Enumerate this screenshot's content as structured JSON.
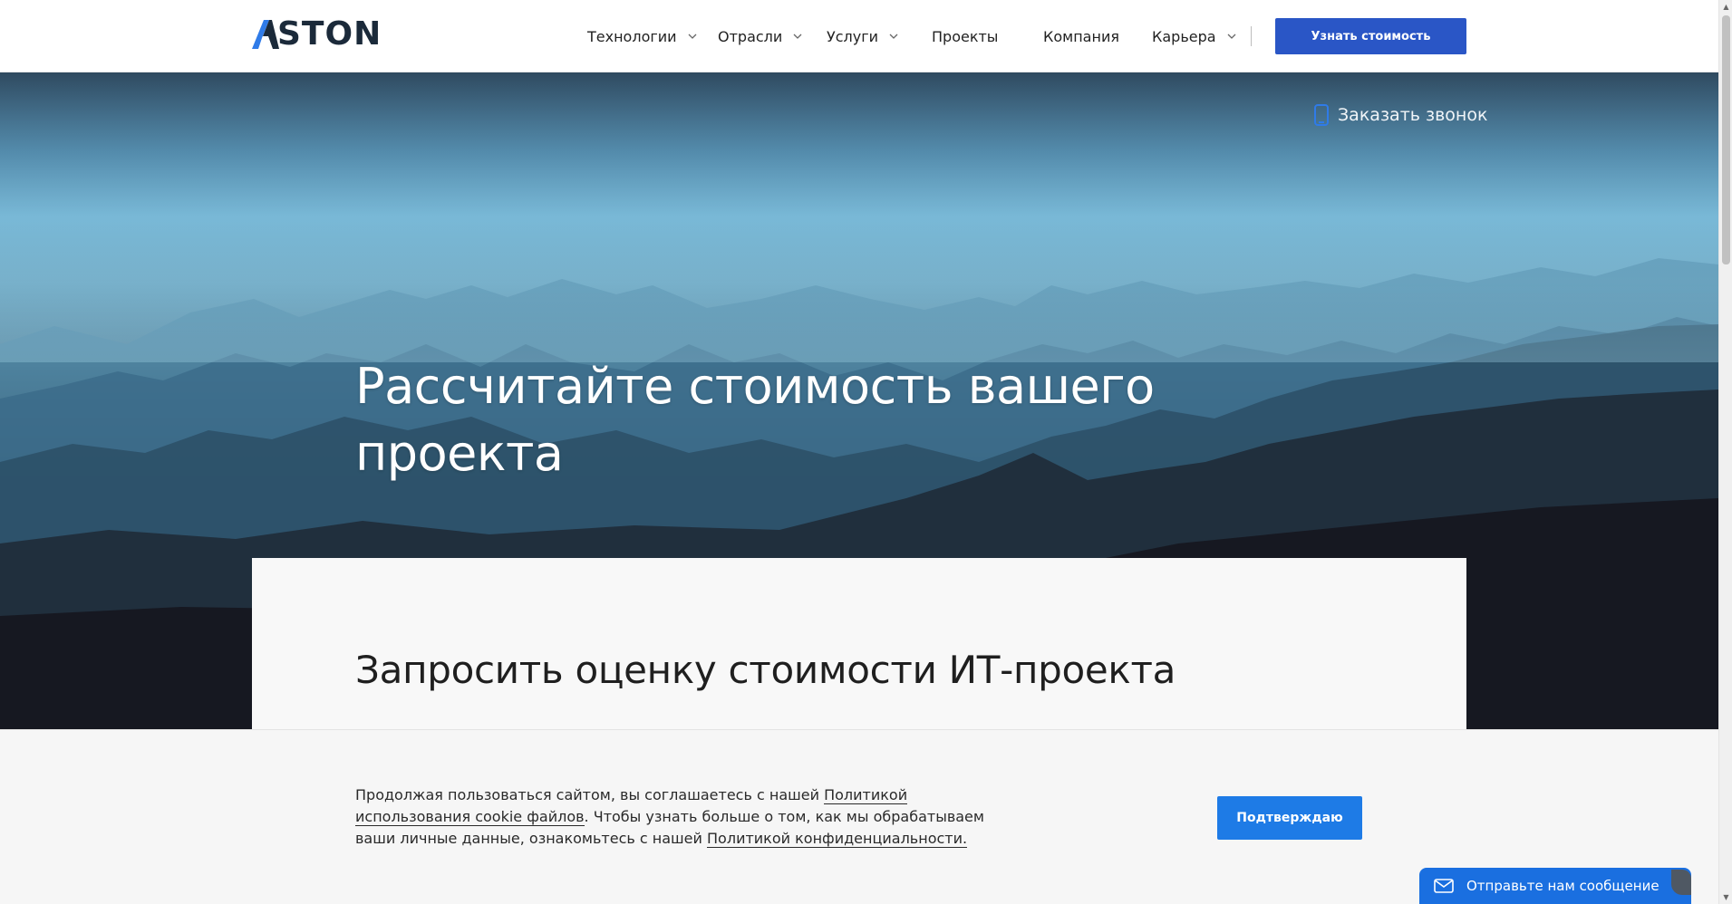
{
  "header": {
    "logo_text": "ASTON",
    "nav": [
      {
        "label": "Технологии",
        "has_dropdown": true
      },
      {
        "label": "Отрасли",
        "has_dropdown": true
      },
      {
        "label": "Услуги",
        "has_dropdown": true
      },
      {
        "label": "Проекты",
        "has_dropdown": false
      },
      {
        "label": "Компания",
        "has_dropdown": false
      },
      {
        "label": "Карьера",
        "has_dropdown": true
      }
    ],
    "cta_label": "Узнать стоимость"
  },
  "hero": {
    "callback_label": "Заказать звонок",
    "title": "Рассчитайте стоимость вашего проекта"
  },
  "card": {
    "title": "Запросить оценку стоимости ИТ-проекта"
  },
  "cookie": {
    "text_1": "Продолжая пользоваться сайтом, вы соглашаетесь с нашей ",
    "link_1": "Политикой использования cookie файлов",
    "text_2": ". Чтобы узнать больше о том, как мы обрабатываем ваши личные данные, ознакомьтесь с нашей ",
    "link_2": "Политикой конфиденциальности.",
    "confirm_label": "Подтверждаю"
  },
  "chat": {
    "label": "Отправьте нам сообщение"
  },
  "icons": {
    "phone": "phone-icon",
    "mail": "mail-icon",
    "chevron": "chevron-down-icon"
  },
  "colors": {
    "brand_blue": "#2a56c6",
    "cookie_button": "#1e7be6",
    "chat": "#1a6fe0",
    "logo_accent": "#2f7be8",
    "logo_dark": "#1b2a3a"
  }
}
